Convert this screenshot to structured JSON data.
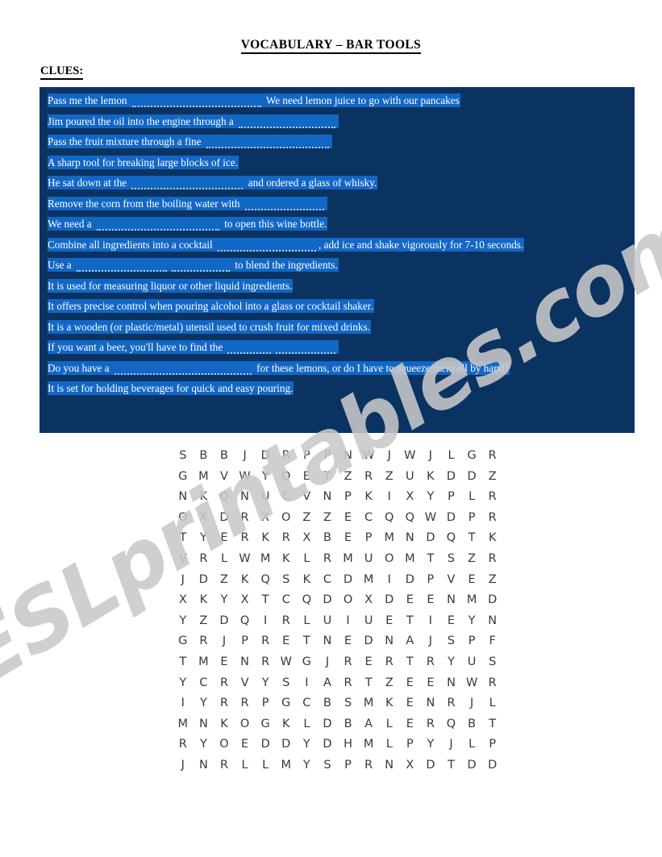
{
  "document": {
    "title": "VOCABULARY – BAR TOOLS",
    "clues_label": "CLUES:",
    "watermark": "ESLprintables.com"
  },
  "colors": {
    "clue_box_background": "#0b3362",
    "clue_highlight": "#1367c4",
    "clue_text": "#ffffff",
    "blank_dots": "#a9d0f2",
    "grid_letter": "#3a3a3a",
    "watermark": "#c9c9c9",
    "page_background": "#ffffff"
  },
  "clues": [
    {
      "id": 1,
      "parts": [
        {
          "type": "text",
          "value": "Pass me the lemon "
        },
        {
          "type": "blank",
          "width": 160
        },
        {
          "type": "text",
          "value": " We need lemon juice to go with our pancakes"
        }
      ]
    },
    {
      "id": 2,
      "parts": [
        {
          "type": "text",
          "value": "Jim poured the oil into the engine through a "
        },
        {
          "type": "blank",
          "width": 120
        }
      ]
    },
    {
      "id": 3,
      "parts": [
        {
          "type": "text",
          "value": "Pass the fruit mixture through a fine "
        },
        {
          "type": "blank",
          "width": 152
        }
      ]
    },
    {
      "id": 4,
      "parts": [
        {
          "type": "text",
          "value": "A sharp tool for breaking large blocks of ice."
        }
      ]
    },
    {
      "id": 5,
      "parts": [
        {
          "type": "text",
          "value": "He sat down at the "
        },
        {
          "type": "blank",
          "width": 138
        },
        {
          "type": "text",
          "value": " and ordered a glass of whisky."
        }
      ]
    },
    {
      "id": 6,
      "parts": [
        {
          "type": "text",
          "value": "Remove the corn from the boiling water with "
        },
        {
          "type": "blank",
          "width": 98
        }
      ]
    },
    {
      "id": 7,
      "parts": [
        {
          "type": "text",
          "value": "We need a "
        },
        {
          "type": "blank",
          "width": 152
        },
        {
          "type": "text",
          "value": " to open this wine bottle."
        }
      ]
    },
    {
      "id": 8,
      "parts": [
        {
          "type": "text",
          "value": "Combine all ingredients into a cocktail "
        },
        {
          "type": "blank",
          "width": 122
        },
        {
          "type": "text",
          "value": ", add ice and shake vigorously for 7-10 seconds."
        }
      ]
    },
    {
      "id": 9,
      "parts": [
        {
          "type": "text",
          "value": "Use a "
        },
        {
          "type": "blank",
          "width": 112
        },
        {
          "type": "blank",
          "width": 72
        },
        {
          "type": "text",
          "value": " to blend the ingredients."
        }
      ]
    },
    {
      "id": 10,
      "parts": [
        {
          "type": "text",
          "value": "It is used for measuring liquor or other liquid ingredients."
        }
      ]
    },
    {
      "id": 11,
      "parts": [
        {
          "type": "text",
          "value": "It offers precise control when pouring alcohol into a glass or cocktail shaker."
        }
      ]
    },
    {
      "id": 12,
      "parts": [
        {
          "type": "text",
          "value": "It is a wooden (or plastic/metal) utensil used to crush fruit for mixed drinks."
        }
      ]
    },
    {
      "id": 13,
      "parts": [
        {
          "type": "text",
          "value": "If you want a beer, you'll have to find the "
        },
        {
          "type": "blank",
          "width": 54
        },
        {
          "type": "blank",
          "width": 74
        }
      ]
    },
    {
      "id": 14,
      "parts": [
        {
          "type": "text",
          "value": "Do you have a "
        },
        {
          "type": "blank",
          "width": 170
        },
        {
          "type": "text",
          "value": " for these lemons, or do I have to squeeze them all by hand?"
        }
      ]
    },
    {
      "id": 15,
      "parts": [
        {
          "type": "text",
          "value": "It is set for holding beverages for quick and easy pouring."
        }
      ]
    }
  ],
  "word_search": {
    "rows": 16,
    "columns": 16,
    "grid": [
      [
        "S",
        "B",
        "B",
        "J",
        "D",
        "R",
        "P",
        "P",
        "N",
        "W",
        "J",
        "W",
        "J",
        "L",
        "G",
        "R"
      ],
      [
        "G",
        "M",
        "V",
        "W",
        "Y",
        "O",
        "E",
        "T",
        "Z",
        "R",
        "Z",
        "U",
        "K",
        "D",
        "D",
        "Z"
      ],
      [
        "N",
        "K",
        "Q",
        "N",
        "U",
        "C",
        "V",
        "N",
        "P",
        "K",
        "I",
        "X",
        "Y",
        "P",
        "L",
        "R"
      ],
      [
        "O",
        "X",
        "D",
        "R",
        "X",
        "O",
        "Z",
        "Z",
        "E",
        "C",
        "Q",
        "Q",
        "W",
        "D",
        "P",
        "R"
      ],
      [
        "T",
        "Y",
        "E",
        "R",
        "K",
        "R",
        "X",
        "B",
        "E",
        "P",
        "M",
        "N",
        "D",
        "Q",
        "T",
        "K"
      ],
      [
        "V",
        "R",
        "L",
        "W",
        "M",
        "K",
        "L",
        "R",
        "M",
        "U",
        "O",
        "M",
        "T",
        "S",
        "Z",
        "R"
      ],
      [
        "J",
        "D",
        "Z",
        "K",
        "Q",
        "S",
        "K",
        "C",
        "D",
        "M",
        "I",
        "D",
        "P",
        "V",
        "E",
        "Z"
      ],
      [
        "X",
        "K",
        "Y",
        "X",
        "T",
        "C",
        "Q",
        "D",
        "O",
        "X",
        "D",
        "E",
        "E",
        "N",
        "M",
        "D"
      ],
      [
        "Y",
        "Z",
        "D",
        "Q",
        "I",
        "R",
        "L",
        "U",
        "I",
        "U",
        "E",
        "T",
        "I",
        "E",
        "Y",
        "N"
      ],
      [
        "G",
        "R",
        "J",
        "P",
        "R",
        "E",
        "T",
        "N",
        "E",
        "D",
        "N",
        "A",
        "J",
        "S",
        "P",
        "F"
      ],
      [
        "T",
        "M",
        "E",
        "N",
        "R",
        "W",
        "G",
        "J",
        "R",
        "E",
        "R",
        "T",
        "R",
        "Y",
        "U",
        "S"
      ],
      [
        "Y",
        "C",
        "R",
        "V",
        "Y",
        "S",
        "I",
        "A",
        "R",
        "T",
        "Z",
        "E",
        "E",
        "N",
        "W",
        "R"
      ],
      [
        "I",
        "Y",
        "R",
        "R",
        "P",
        "G",
        "C",
        "B",
        "S",
        "M",
        "K",
        "E",
        "N",
        "R",
        "J",
        "L"
      ],
      [
        "M",
        "N",
        "K",
        "O",
        "G",
        "K",
        "L",
        "D",
        "B",
        "A",
        "L",
        "E",
        "R",
        "Q",
        "B",
        "T"
      ],
      [
        "R",
        "Y",
        "O",
        "E",
        "D",
        "D",
        "Y",
        "D",
        "H",
        "M",
        "L",
        "P",
        "Y",
        "J",
        "L",
        "P"
      ],
      [
        "J",
        "N",
        "R",
        "L",
        "L",
        "M",
        "Y",
        "S",
        "P",
        "R",
        "N",
        "X",
        "D",
        "T",
        "D",
        "D"
      ]
    ]
  }
}
